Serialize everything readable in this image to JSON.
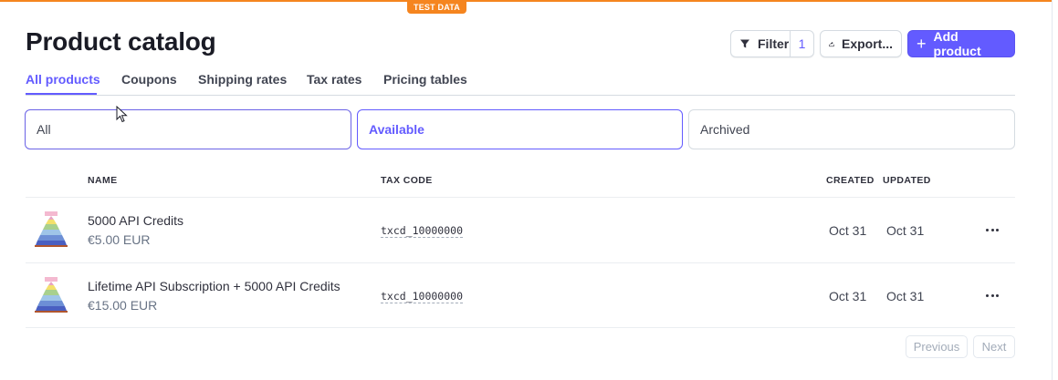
{
  "banner": {
    "label": "TEST DATA",
    "color": "#f5851f"
  },
  "header": {
    "title": "Product catalog",
    "filter_label": "Filter",
    "filter_count": "1",
    "export_label": "Export...",
    "add_label": "Add product"
  },
  "tabs": [
    {
      "label": "All products",
      "active": true
    },
    {
      "label": "Coupons",
      "active": false
    },
    {
      "label": "Shipping rates",
      "active": false
    },
    {
      "label": "Tax rates",
      "active": false
    },
    {
      "label": "Pricing tables",
      "active": false
    }
  ],
  "segments": [
    {
      "label": "All",
      "state": "hover"
    },
    {
      "label": "Available",
      "state": "selected"
    },
    {
      "label": "Archived",
      "state": "default"
    }
  ],
  "table": {
    "columns": [
      "NAME",
      "TAX CODE",
      "CREATED",
      "UPDATED"
    ],
    "rows": [
      {
        "name": "5000 API Credits",
        "price": "€5.00 EUR",
        "tax_code": "txcd_10000000",
        "created": "Oct 31",
        "updated": "Oct 31"
      },
      {
        "name": "Lifetime API Subscription + 5000 API Credits",
        "price": "€15.00 EUR",
        "tax_code": "txcd_10000000",
        "created": "Oct 31",
        "updated": "Oct 31"
      }
    ]
  },
  "pagination": {
    "previous": "Previous",
    "next": "Next"
  },
  "colors": {
    "accent": "#635bff",
    "text": "#30313d",
    "muted": "#687385",
    "border": "#d5dbe1"
  },
  "icons": [
    "filter-icon",
    "export-icon",
    "plus-icon",
    "more-icon",
    "cursor-icon",
    "product-thumbnail"
  ]
}
